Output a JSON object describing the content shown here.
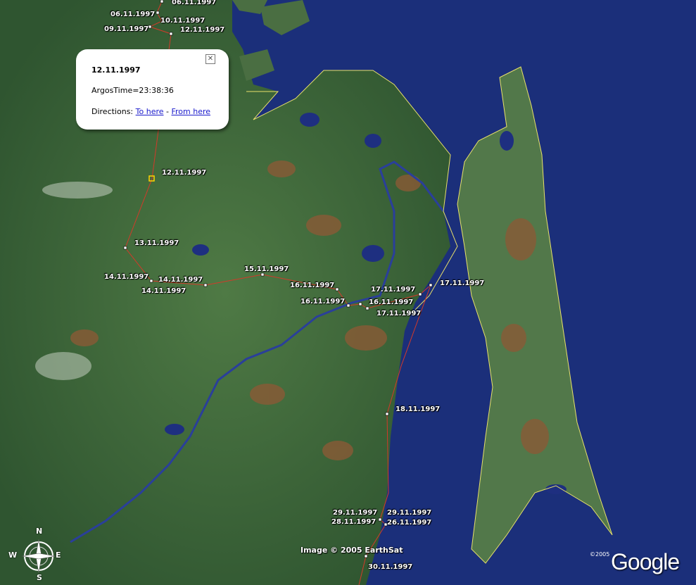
{
  "colors": {
    "ocean": "#1b2f7a",
    "land": "#3f6b3a",
    "track": "#d23a2a",
    "border": "#e8e06a",
    "river": "#2a3f9a"
  },
  "popup": {
    "title": "12.11.1997",
    "argos_time": "ArgosTime=23:38:36",
    "directions_prefix": "Directions: ",
    "to_here": "To here",
    "separator": " - ",
    "from_here": "From here",
    "close_icon": "close-icon"
  },
  "waypoints": [
    {
      "id": "wp0",
      "label": "06.11.1997"
    },
    {
      "id": "wp1",
      "label": "06.11.1997"
    },
    {
      "id": "wp2",
      "label": "10.11.1997"
    },
    {
      "id": "wp3",
      "label": "09.11.1997"
    },
    {
      "id": "wp4",
      "label": "12.11.1997"
    },
    {
      "id": "wp5",
      "label": "12.11.1997"
    },
    {
      "id": "wp6",
      "label": "13.11.1997"
    },
    {
      "id": "wp7",
      "label": "14.11.1997"
    },
    {
      "id": "wp8",
      "label": "14.11.1997"
    },
    {
      "id": "wp9",
      "label": "14.11.1997"
    },
    {
      "id": "wp10",
      "label": "15.11.1997"
    },
    {
      "id": "wp11",
      "label": "16.11.1997"
    },
    {
      "id": "wp12",
      "label": "16.11.1997"
    },
    {
      "id": "wp13",
      "label": "17.11.1997"
    },
    {
      "id": "wp14",
      "label": "16.11.1997"
    },
    {
      "id": "wp15",
      "label": "17.11.1997"
    },
    {
      "id": "wp16",
      "label": "17.11.1997"
    },
    {
      "id": "wp17",
      "label": "18.11.1997"
    },
    {
      "id": "wp18",
      "label": "29.11.1997"
    },
    {
      "id": "wp19",
      "label": "29.11.1997"
    },
    {
      "id": "wp20",
      "label": "28.11.1997"
    },
    {
      "id": "wp21",
      "label": "26.11.1997"
    },
    {
      "id": "wp22",
      "label": "30.11.1997"
    }
  ],
  "attribution": "Image © 2005 EarthSat",
  "google": {
    "year": "©2005",
    "logo": "Google"
  },
  "compass": {
    "n": "N",
    "s": "S",
    "e": "E",
    "w": "W",
    "icon": "compass-icon"
  }
}
